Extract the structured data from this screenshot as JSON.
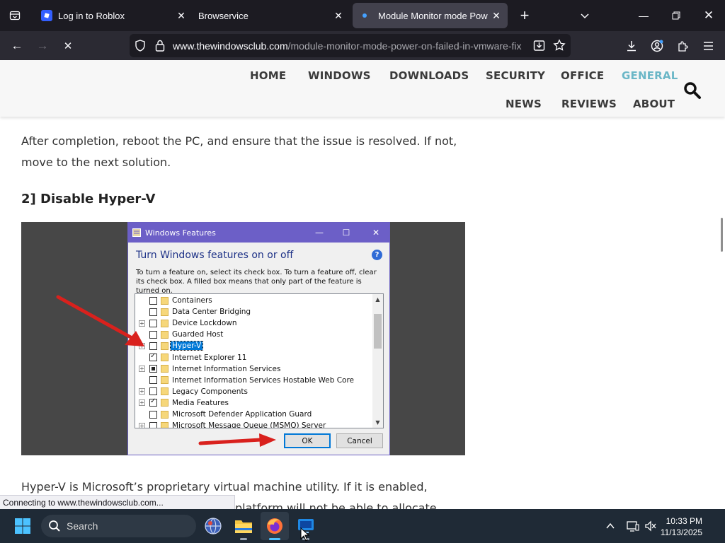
{
  "browser": {
    "tabs": [
      {
        "title": "Log in to Roblox",
        "active": false,
        "favicon_color": "#335fff"
      },
      {
        "title": "Browservice",
        "active": false
      },
      {
        "title": "Module Monitor mode Power o",
        "active": true
      }
    ],
    "address": {
      "domain": "www.thewindowsclub.com",
      "path": "/module-monitor-mode-power-on-failed-in-vmware-fix"
    },
    "status": "Connecting to www.thewindowsclub.com..."
  },
  "site": {
    "menu": [
      "HOME",
      "WINDOWS",
      "DOWNLOADS",
      "SECURITY",
      "OFFICE",
      "GENERAL",
      "NEWS",
      "REVIEWS",
      "ABOUT"
    ],
    "active_menu": "GENERAL",
    "accent": "#6bb7c7"
  },
  "article": {
    "p1": "After completion, reboot the PC, and ensure that the issue is resolved. If not, move to the next solution.",
    "heading": "2] Disable Hyper-V",
    "p2_line1": "Hyper-V is Microsoft’s proprietary virtual machine utility. If it is enabled,",
    "p2_line2": "platform will not be able to allocate"
  },
  "dialog": {
    "title": "Windows Features",
    "heading": "Turn Windows features on or off",
    "description": "To turn a feature on, select its check box. To turn a feature off, clear its check box. A filled box means that only part of the feature is turned on.",
    "features": [
      {
        "label": "Containers",
        "expandable": false,
        "state": "unchecked"
      },
      {
        "label": "Data Center Bridging",
        "expandable": false,
        "state": "unchecked"
      },
      {
        "label": "Device Lockdown",
        "expandable": true,
        "state": "unchecked"
      },
      {
        "label": "Guarded Host",
        "expandable": false,
        "state": "unchecked"
      },
      {
        "label": "Hyper-V",
        "expandable": true,
        "state": "unchecked",
        "selected": true
      },
      {
        "label": "Internet Explorer 11",
        "expandable": false,
        "state": "checked"
      },
      {
        "label": "Internet Information Services",
        "expandable": true,
        "state": "partial"
      },
      {
        "label": "Internet Information Services Hostable Web Core",
        "expandable": false,
        "state": "unchecked"
      },
      {
        "label": "Legacy Components",
        "expandable": true,
        "state": "unchecked"
      },
      {
        "label": "Media Features",
        "expandable": true,
        "state": "checked"
      },
      {
        "label": "Microsoft Defender Application Guard",
        "expandable": false,
        "state": "unchecked"
      },
      {
        "label": "Microsoft Message Queue (MSMQ) Server",
        "expandable": true,
        "state": "unchecked"
      }
    ],
    "ok_label": "OK",
    "cancel_label": "Cancel"
  },
  "taskbar": {
    "search_placeholder": "Search",
    "time": "10:33 PM",
    "date": "11/13/2025"
  }
}
